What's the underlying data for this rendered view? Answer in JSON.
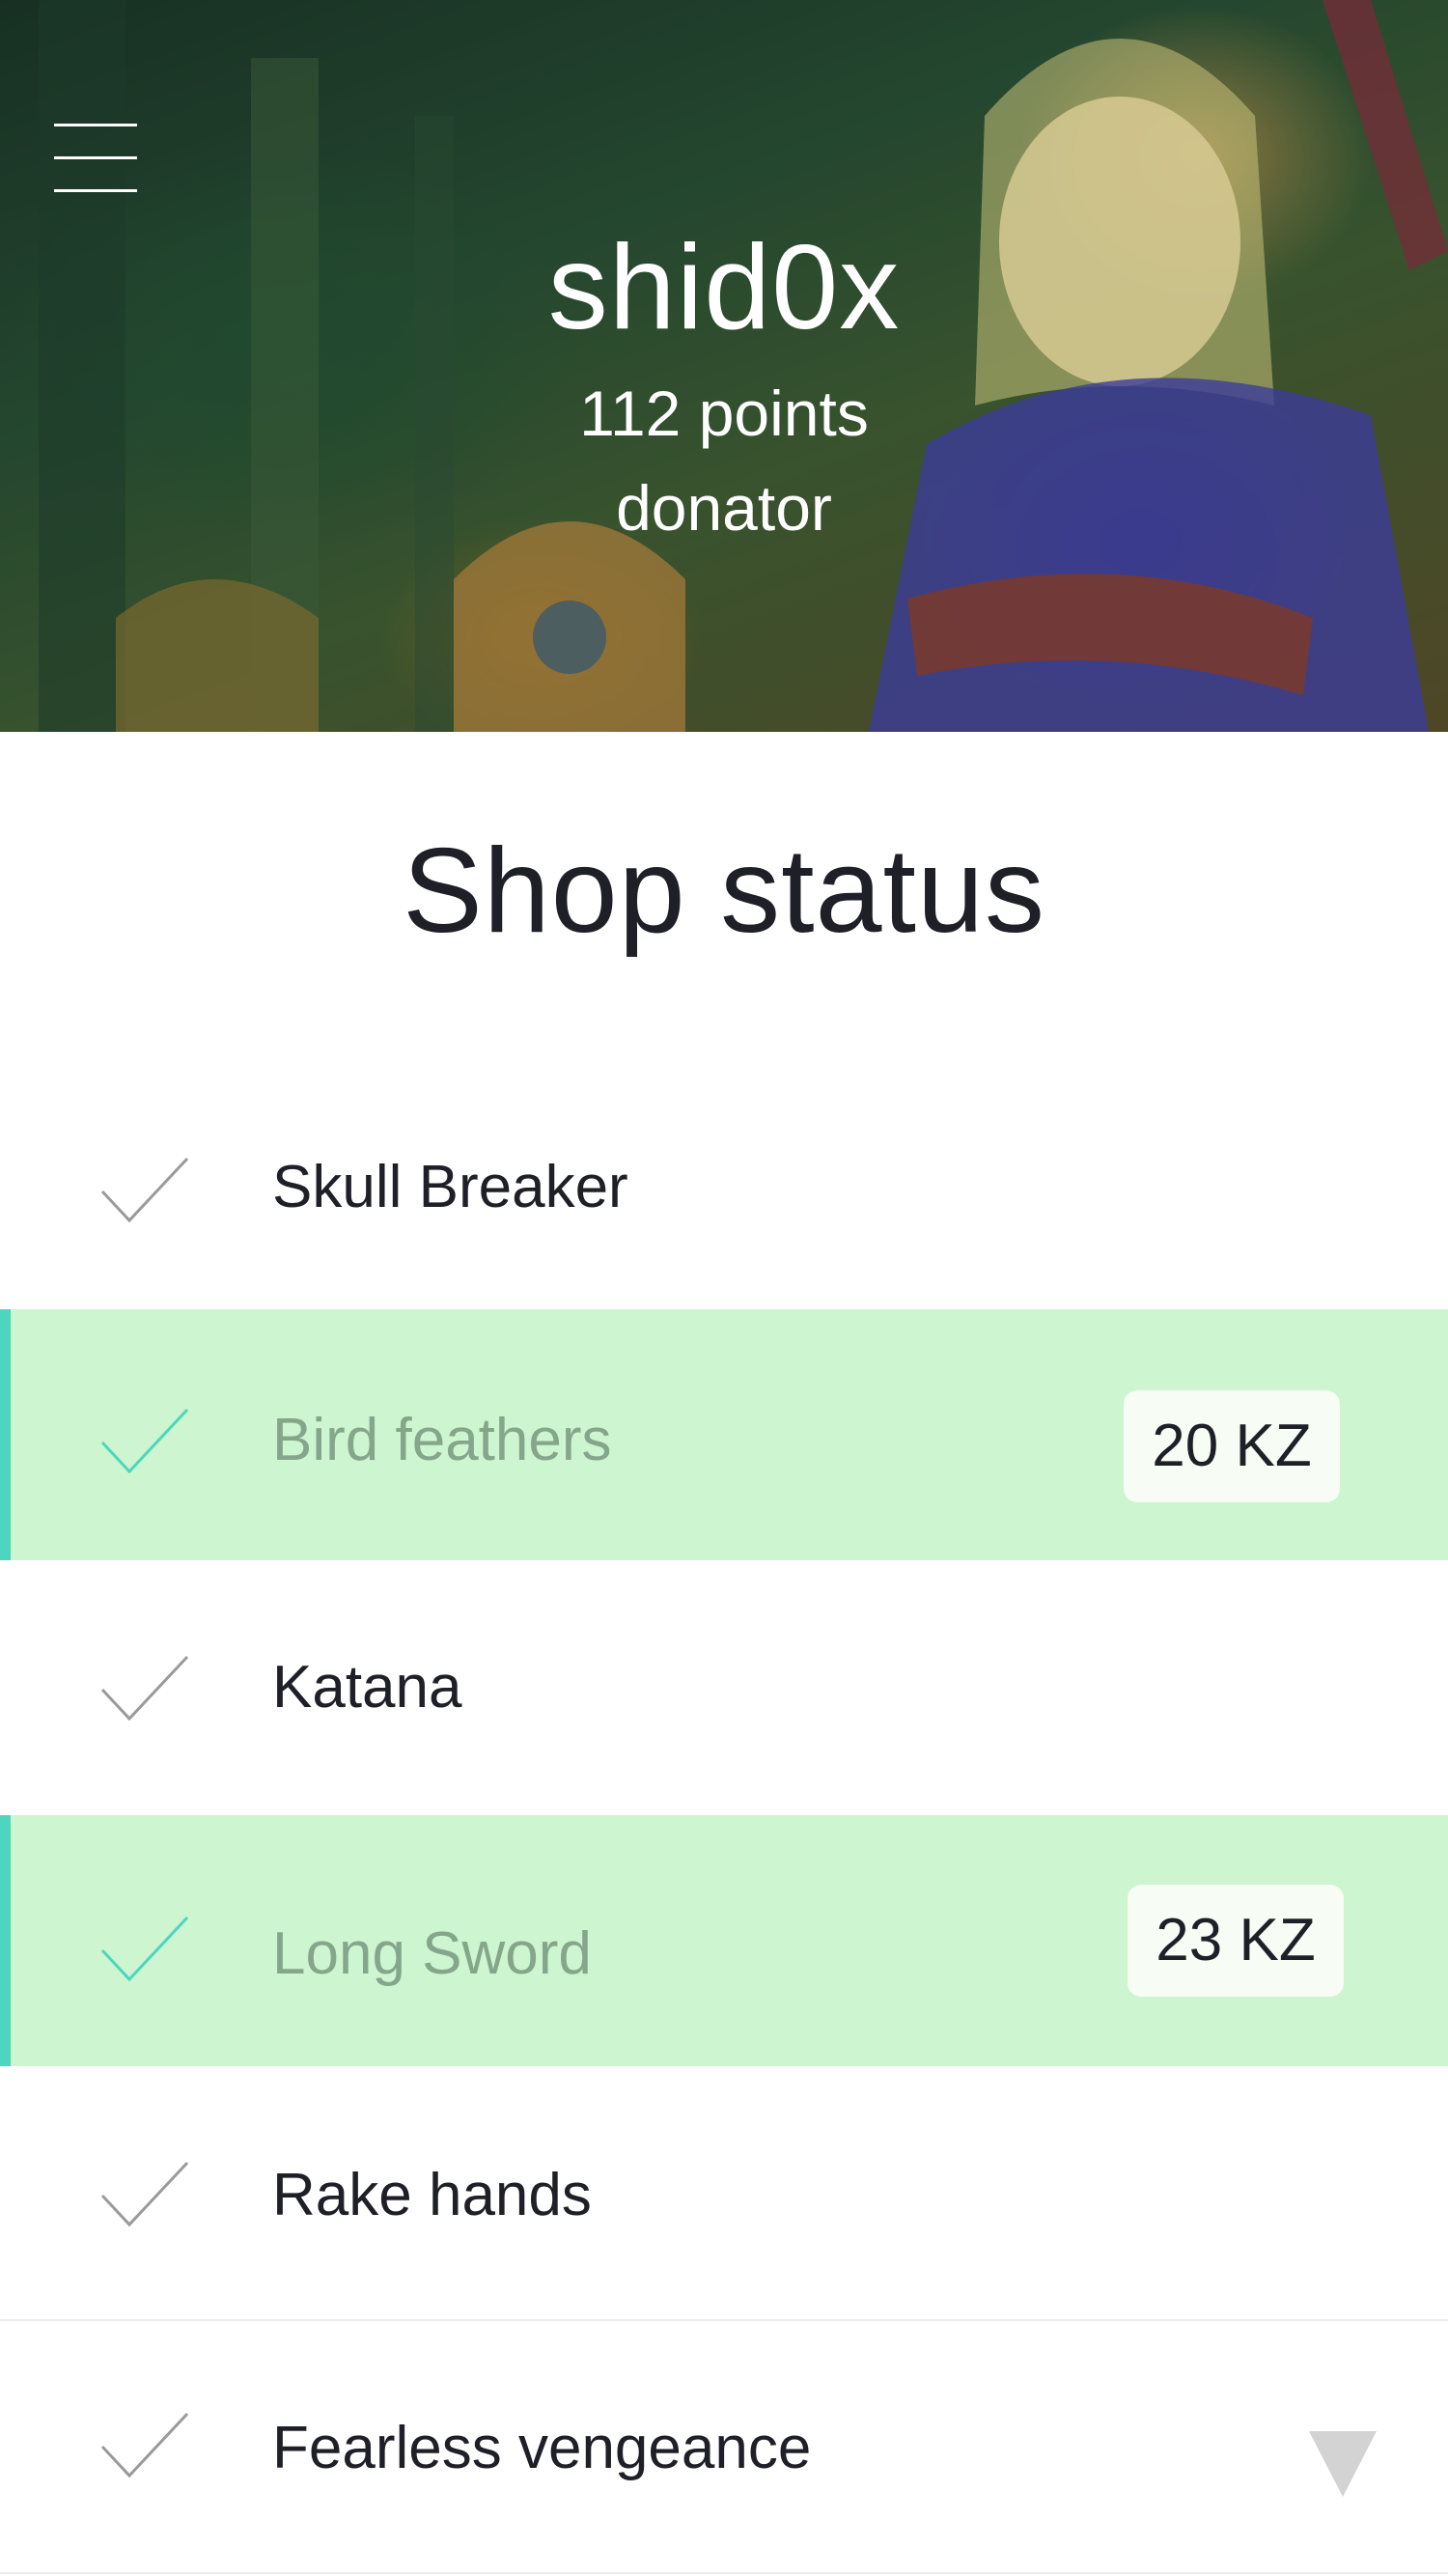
{
  "header": {
    "username": "shid0x",
    "points": "112 points",
    "role": "donator"
  },
  "page_title": "Shop status",
  "items": [
    {
      "label": "Skull Breaker",
      "selected": false,
      "price": ""
    },
    {
      "label": "Bird feathers",
      "selected": true,
      "price": "20 KZ"
    },
    {
      "label": "Katana",
      "selected": false,
      "price": ""
    },
    {
      "label": "Long Sword",
      "selected": true,
      "price": "23 KZ"
    },
    {
      "label": "Rake hands",
      "selected": false,
      "price": ""
    },
    {
      "label": "Fearless vengeance",
      "selected": false,
      "price": ""
    }
  ],
  "icons": {
    "menu": "hamburger-menu-icon",
    "check": "check-icon",
    "dropdown": "triangle-down-icon"
  },
  "colors": {
    "highlight_bg": "#cdf5cf",
    "accent": "#4dd6bf",
    "check_inactive": "#9a9a9a",
    "label_dim": "#86a68c"
  }
}
